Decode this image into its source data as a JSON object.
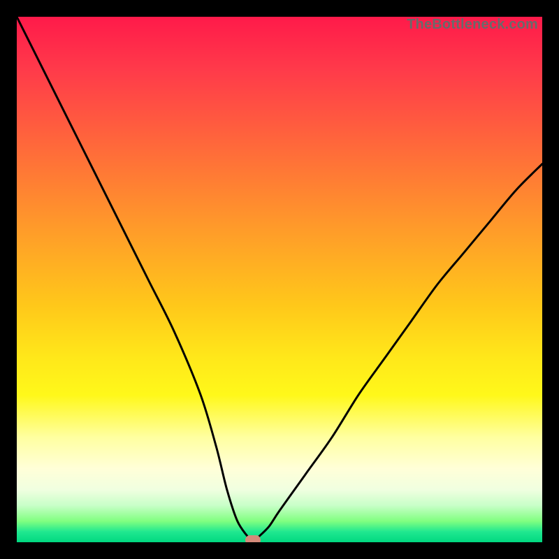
{
  "watermark": "TheBottleneck.com",
  "chart_data": {
    "type": "line",
    "title": "",
    "xlabel": "",
    "ylabel": "",
    "xlim": [
      0,
      100
    ],
    "ylim": [
      0,
      100
    ],
    "series": [
      {
        "name": "bottleneck-curve",
        "x": [
          0,
          5,
          10,
          15,
          20,
          25,
          30,
          35,
          38,
          40,
          42,
          44,
          45,
          46,
          48,
          50,
          55,
          60,
          65,
          70,
          75,
          80,
          85,
          90,
          95,
          100
        ],
        "values": [
          100,
          90,
          80,
          70,
          60,
          50,
          40,
          28,
          18,
          10,
          4,
          1,
          0,
          1,
          3,
          6,
          13,
          20,
          28,
          35,
          42,
          49,
          55,
          61,
          67,
          72
        ]
      }
    ],
    "marker": {
      "x": 45,
      "y": 0
    }
  }
}
